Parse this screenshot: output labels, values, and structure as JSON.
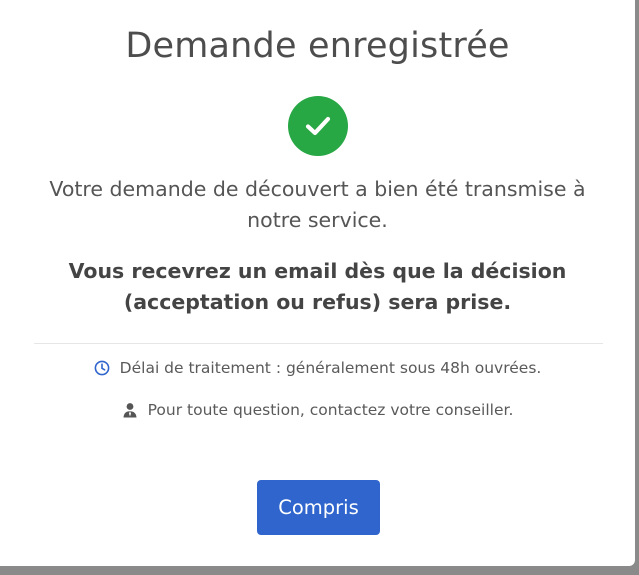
{
  "dialog": {
    "title": "Demande enregistrée",
    "success_icon": "check-circle-icon",
    "message": "Votre demande de découvert a bien été transmise à notre service.",
    "notice": "Vous recevrez un email dès que la décision (acceptation ou refus) sera prise.",
    "info": [
      {
        "icon": "clock-icon",
        "text": "Délai de traitement : généralement sous 48h ouvrées."
      },
      {
        "icon": "user-icon",
        "text": "Pour toute question, contactez votre conseiller."
      }
    ],
    "button_label": "Compris"
  },
  "colors": {
    "success": "#28a745",
    "primary": "#2f65cc",
    "clock_icon": "#2f65cc",
    "user_icon": "#555555"
  }
}
